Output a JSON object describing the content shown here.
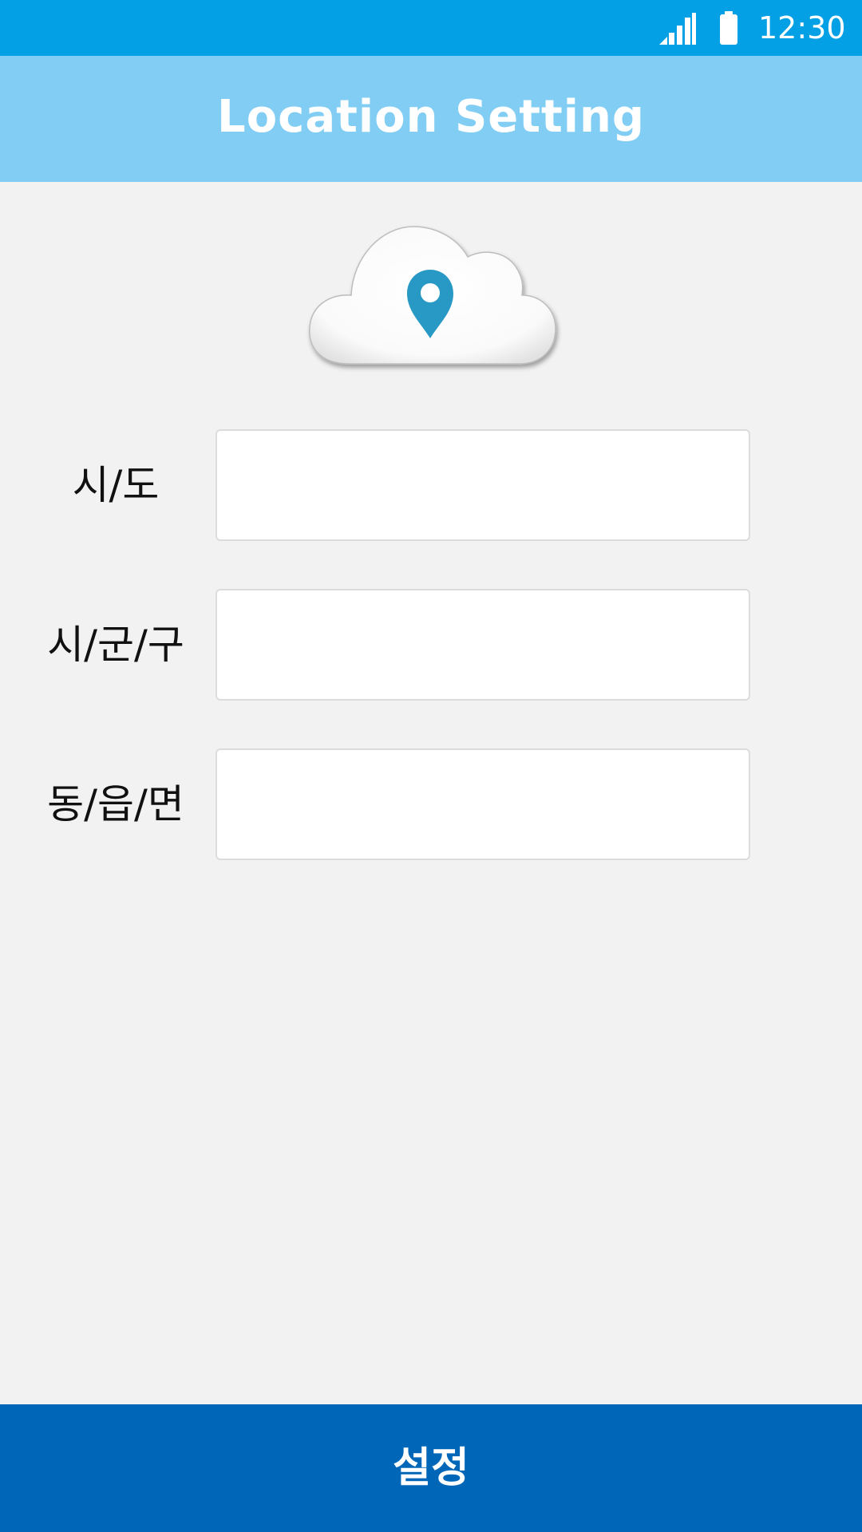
{
  "status_bar": {
    "time": "12:30",
    "icons": [
      "signal-icon",
      "battery-icon"
    ],
    "background": "#03a0e6"
  },
  "header": {
    "title": "Location Setting",
    "background": "#81cdf3"
  },
  "logo": {
    "icon": "cloud-location-pin-icon",
    "pin_color": "#2899c4"
  },
  "form": {
    "fields": [
      {
        "label": "시/도",
        "value": "",
        "placeholder": ""
      },
      {
        "label": "시/군/구",
        "value": "",
        "placeholder": ""
      },
      {
        "label": "동/읍/면",
        "value": "",
        "placeholder": ""
      }
    ]
  },
  "footer": {
    "button_label": "설정",
    "background": "#0067b8"
  }
}
